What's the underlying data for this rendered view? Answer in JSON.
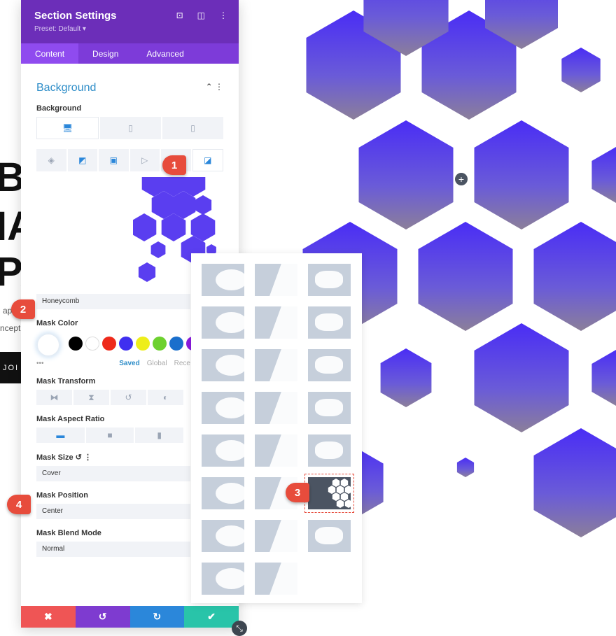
{
  "page_bg_text": {
    "line1": "BA",
    "line2": "IA",
    "line3": "PA",
    "text1": "ap",
    "text2": "ncept",
    "button": "JOI"
  },
  "panel": {
    "title": "Section Settings",
    "preset": "Preset: Default ▾",
    "header_icons": [
      "focus-icon",
      "split-view-icon",
      "more-icon"
    ],
    "tabs": [
      {
        "label": "Content",
        "active": true
      },
      {
        "label": "Design"
      },
      {
        "label": "Advanced"
      }
    ],
    "section_title": "Background",
    "background_label": "Background",
    "devices": [
      "desktop-icon",
      "tablet-icon",
      "phone-icon"
    ],
    "bg_types": [
      "color-icon",
      "gradient-icon",
      "image-icon",
      "video-icon",
      "pattern-icon",
      "mask-icon"
    ],
    "mask_style_value": "Honeycomb",
    "mask_color_label": "Mask Color",
    "swatches": [
      "#000000",
      "#ffffff",
      "#ee2a1b",
      "#3f2ff0",
      "#eeee1a",
      "#6dd12f",
      "#1a6fcc",
      "#8b1ae0"
    ],
    "palette_tabs": [
      "Saved",
      "Global",
      "Rece"
    ],
    "mask_transform_label": "Mask Transform",
    "mask_aspect_label": "Mask Aspect Ratio",
    "mask_size_label": "Mask Size",
    "mask_size_value": "Cover",
    "mask_position_label": "Mask Position",
    "mask_position_value": "Center",
    "mask_blend_label": "Mask Blend Mode",
    "mask_blend_value": "Normal",
    "footer": [
      {
        "icon": "✖",
        "color": "#ef5555"
      },
      {
        "icon": "↺",
        "color": "#7e3bd0"
      },
      {
        "icon": "↻",
        "color": "#2b87da"
      },
      {
        "icon": "✔",
        "color": "#29c4a9"
      }
    ]
  },
  "badges": [
    "1",
    "2",
    "3",
    "4"
  ],
  "colors": {
    "header": "#6c2eb9",
    "tabs": "#7d3bd9",
    "accent": "#2b87da",
    "hex": "#5b3cf0"
  }
}
